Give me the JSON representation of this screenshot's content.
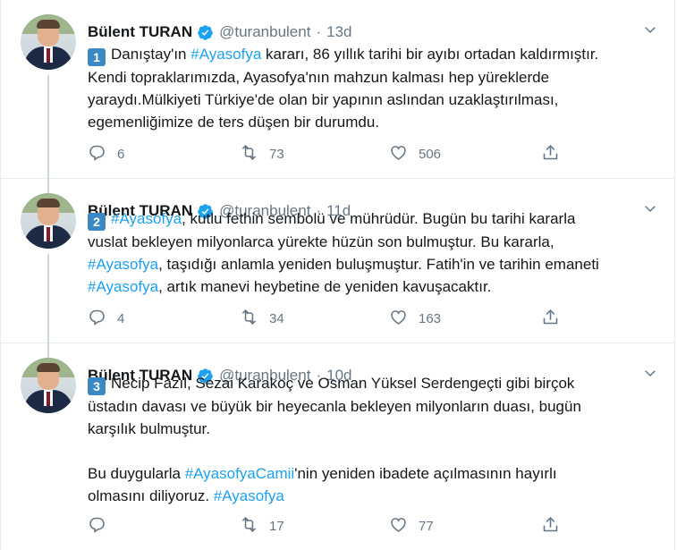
{
  "tweets": [
    {
      "name": "Bülent TURAN",
      "handle": "@turanbulent",
      "time": "13d",
      "badge": "1",
      "lines": [
        [
          {
            "t": "Danıştay'ın "
          },
          {
            "t": "#Ayasofya",
            "h": true
          },
          {
            "t": " kararı, 86 yıllık tarihi bir ayıbı ortadan kaldırmıştır."
          }
        ],
        [
          {
            "t": "Kendi topraklarımızda, Ayasofya'nın mahzun kalması hep yüreklerde"
          }
        ],
        [
          {
            "t": "yaraydı.Mülkiyeti Türkiye'de olan bir yapının aslından uzaklaştırılması,"
          }
        ],
        [
          {
            "t": "egemenliğimize de ters düşen bir durumdu."
          }
        ]
      ],
      "replies": "6",
      "retweets": "73",
      "likes": "506"
    },
    {
      "name": "Bülent TURAN",
      "handle": "@turanbulent",
      "time": "11d",
      "badge": "2",
      "lines": [
        [
          {
            "t": "#Ayasofya",
            "h": true
          },
          {
            "t": ", kutlu fethin sembolü ve mührüdür. Bugün bu tarihi kararla"
          }
        ],
        [
          {
            "t": "vuslat bekleyen milyonlarca yürekte hüzün son bulmuştur. Bu kararla,"
          }
        ],
        [
          {
            "t": "#Ayasofya",
            "h": true
          },
          {
            "t": ", taşıdığı anlamla yeniden buluşmuştur. Fatih'in ve tarihin emaneti"
          }
        ],
        [
          {
            "t": "#Ayasofya",
            "h": true
          },
          {
            "t": ", artık manevi heybetine de yeniden kavuşacaktır."
          }
        ]
      ],
      "replies": "4",
      "retweets": "34",
      "likes": "163"
    },
    {
      "name": "Bülent TURAN",
      "handle": "@turanbulent",
      "time": "10d",
      "badge": "3",
      "lines": [
        [
          {
            "t": "Necip Fazıl, Sezai Karakoç ve Osman Yüksel Serdengeçti gibi birçok"
          }
        ],
        [
          {
            "t": "üstadın davası ve büyük bir heyecanla bekleyen milyonların duası, bugün"
          }
        ],
        [
          {
            "t": "karşılık bulmuştur."
          }
        ],
        [
          {
            "t": ""
          }
        ],
        [
          {
            "t": "Bu duygularla "
          },
          {
            "t": "#AyasofyaCamii",
            "h": true
          },
          {
            "t": "'nin yeniden ibadete açılmasının hayırlı"
          }
        ],
        [
          {
            "t": "olmasını diliyoruz. "
          },
          {
            "t": "#Ayasofya",
            "h": true
          }
        ]
      ],
      "replies": "",
      "retweets": "17",
      "likes": "77"
    }
  ],
  "colors": {
    "hashtag": "#1da1f2",
    "verified": "#1da1f2",
    "muted": "#657786",
    "badge": "#3b88c3"
  },
  "icons": [
    "verified-icon",
    "chevron-down-icon",
    "reply-icon",
    "retweet-icon",
    "like-icon",
    "share-icon"
  ]
}
